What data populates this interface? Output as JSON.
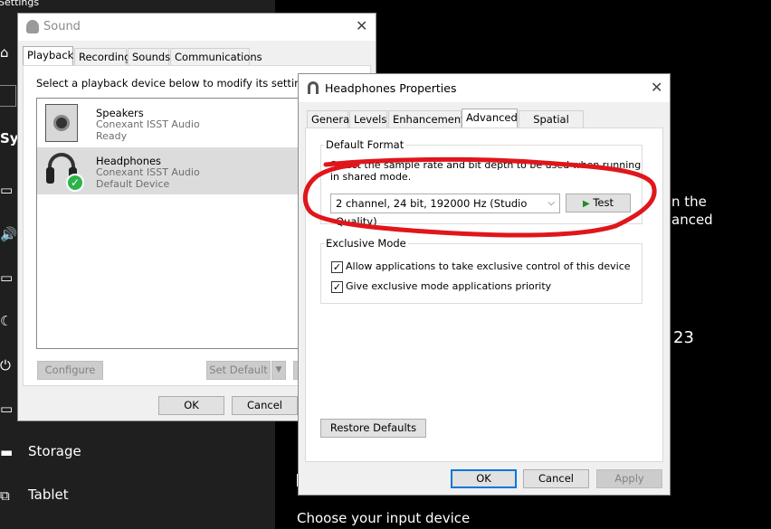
{
  "settings": {
    "title": "Settings",
    "section_partial": "Sys",
    "sidebar": [
      {
        "label": "Storage",
        "icon": "storage-icon"
      },
      {
        "label": "Tablet",
        "icon": "tablet-icon"
      }
    ],
    "right_text_1": "n the",
    "right_text_2": "anced",
    "right_number": "23",
    "input_heading": "Choose your input device"
  },
  "sound_dialog": {
    "title": "Sound",
    "tabs": [
      "Playback",
      "Recording",
      "Sounds",
      "Communications"
    ],
    "instruction": "Select a playback device below to modify its settings:",
    "devices": [
      {
        "name": "Speakers",
        "driver": "Conexant ISST Audio",
        "status": "Ready"
      },
      {
        "name": "Headphones",
        "driver": "Conexant ISST Audio",
        "status": "Default Device"
      }
    ],
    "configure_label": "Configure",
    "set_default_label": "Set Default",
    "ok_label": "OK",
    "cancel_label": "Cancel"
  },
  "props_dialog": {
    "title": "Headphones Properties",
    "tabs": [
      "General",
      "Levels",
      "Enhancements",
      "Advanced",
      "Spatial sound"
    ],
    "default_format": {
      "group_label": "Default Format",
      "description_line1": "Select the sample rate and bit depth to be used when running",
      "description_line2": "in shared mode.",
      "selected_format": "2 channel, 24 bit, 192000 Hz (Studio Quality)",
      "test_label": "Test"
    },
    "exclusive_mode": {
      "group_label": "Exclusive Mode",
      "options": [
        {
          "label": "Allow applications to take exclusive control of this device",
          "checked": true
        },
        {
          "label": "Give exclusive mode applications priority",
          "checked": true
        }
      ]
    },
    "restore_label": "Restore Defaults",
    "ok_label": "OK",
    "cancel_label": "Cancel",
    "apply_label": "Apply"
  },
  "colors": {
    "annotation": "#e0161b",
    "check": "#2db34a",
    "focus": "#0078d7"
  }
}
